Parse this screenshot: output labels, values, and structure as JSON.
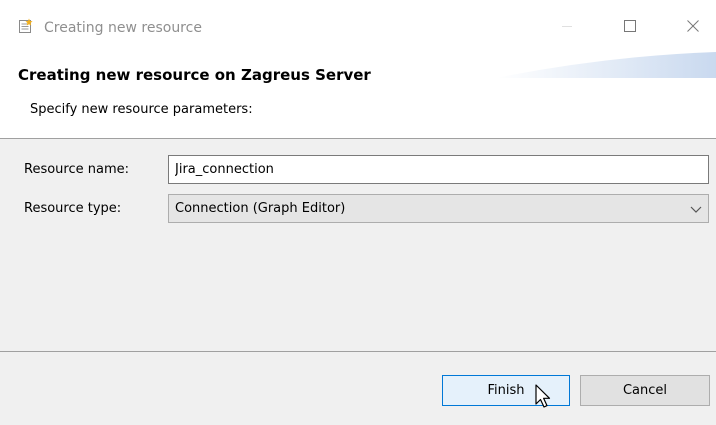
{
  "window": {
    "title": "Creating new resource",
    "icon": "new-resource-icon",
    "controls": [
      "minimize-icon",
      "maximize-icon",
      "close-icon"
    ]
  },
  "banner": {
    "title": "Creating new resource on Zagreus Server",
    "subtitle": "Specify new resource parameters:"
  },
  "form": {
    "resource_name_label": "Resource name:",
    "resource_name_value": "Jira_connection",
    "resource_type_label": "Resource type:",
    "resource_type_value": "Connection (Graph Editor)"
  },
  "buttons": {
    "finish_label": "Finish",
    "cancel_label": "Cancel"
  },
  "colors": {
    "focused_button_border": "#0078d7",
    "focused_button_bg": "#e5f1fb",
    "panel_bg": "#f0f0f0"
  }
}
